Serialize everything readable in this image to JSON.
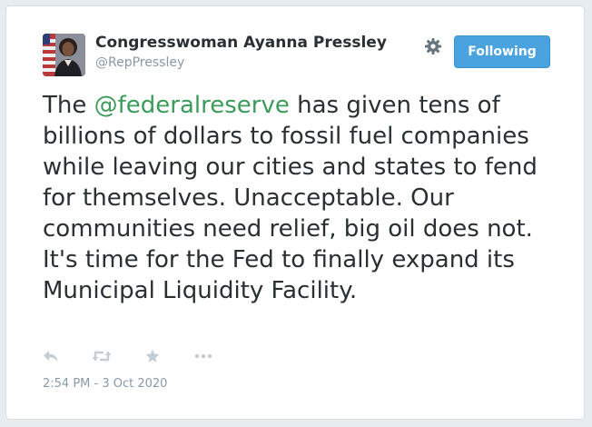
{
  "author": {
    "name": "Congresswoman Ayanna Pressley",
    "handle": "@RepPressley"
  },
  "follow_button": {
    "label": "Following"
  },
  "tweet": {
    "text_before": "The ",
    "mention": "@federalreserve",
    "text_after": " has given tens of billions of dollars to fossil fuel companies while leaving our cities and states to fend for themselves. Unacceptable. Our communities need relief, big oil does not. It's time for the Fed to finally expand its Municipal Liquidity Facility.",
    "timestamp": "2:54 PM - 3 Oct 2020"
  },
  "actions": [
    {
      "icon": "reply-icon"
    },
    {
      "icon": "retweet-icon"
    },
    {
      "icon": "favorite-star-icon"
    },
    {
      "icon": "more-options-icon"
    }
  ],
  "colors": {
    "mention": "#3b9b5a",
    "follow_button_bg": "#4aa3df",
    "icon_gray": "#c4cdd4"
  }
}
